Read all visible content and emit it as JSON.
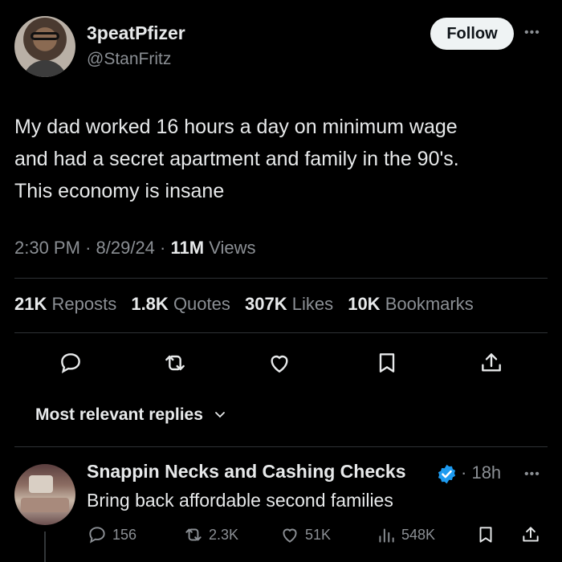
{
  "tweet": {
    "display_name": "3peatPfizer",
    "handle": "@StanFritz",
    "follow_label": "Follow",
    "text": "My dad worked 16 hours a day on minimum wage\nand had a secret apartment and family in the 90's.\nThis economy is insane",
    "time": "2:30 PM",
    "date": "8/29/24",
    "views_count": "11M",
    "views_label": "Views",
    "stats": {
      "reposts_count": "21K",
      "reposts_label": "Reposts",
      "quotes_count": "1.8K",
      "quotes_label": "Quotes",
      "likes_count": "307K",
      "likes_label": "Likes",
      "bookmarks_count": "10K",
      "bookmarks_label": "Bookmarks"
    },
    "actions": [
      "reply-icon",
      "repost-icon",
      "like-icon",
      "bookmark-icon",
      "share-icon"
    ]
  },
  "replies_sort": {
    "label": "Most relevant replies"
  },
  "reply": {
    "display_name": "Snappin Necks and Cashing Checks",
    "time": "18h",
    "text": "Bring back affordable second families",
    "replies": "156",
    "reposts": "2.3K",
    "likes": "51K",
    "views": "548K"
  },
  "colors": {
    "background": "#000000",
    "text": "#e7e9ea",
    "muted": "#8b8f94",
    "verified": "#1d9bf0",
    "follow_button": "#eff3f4"
  }
}
